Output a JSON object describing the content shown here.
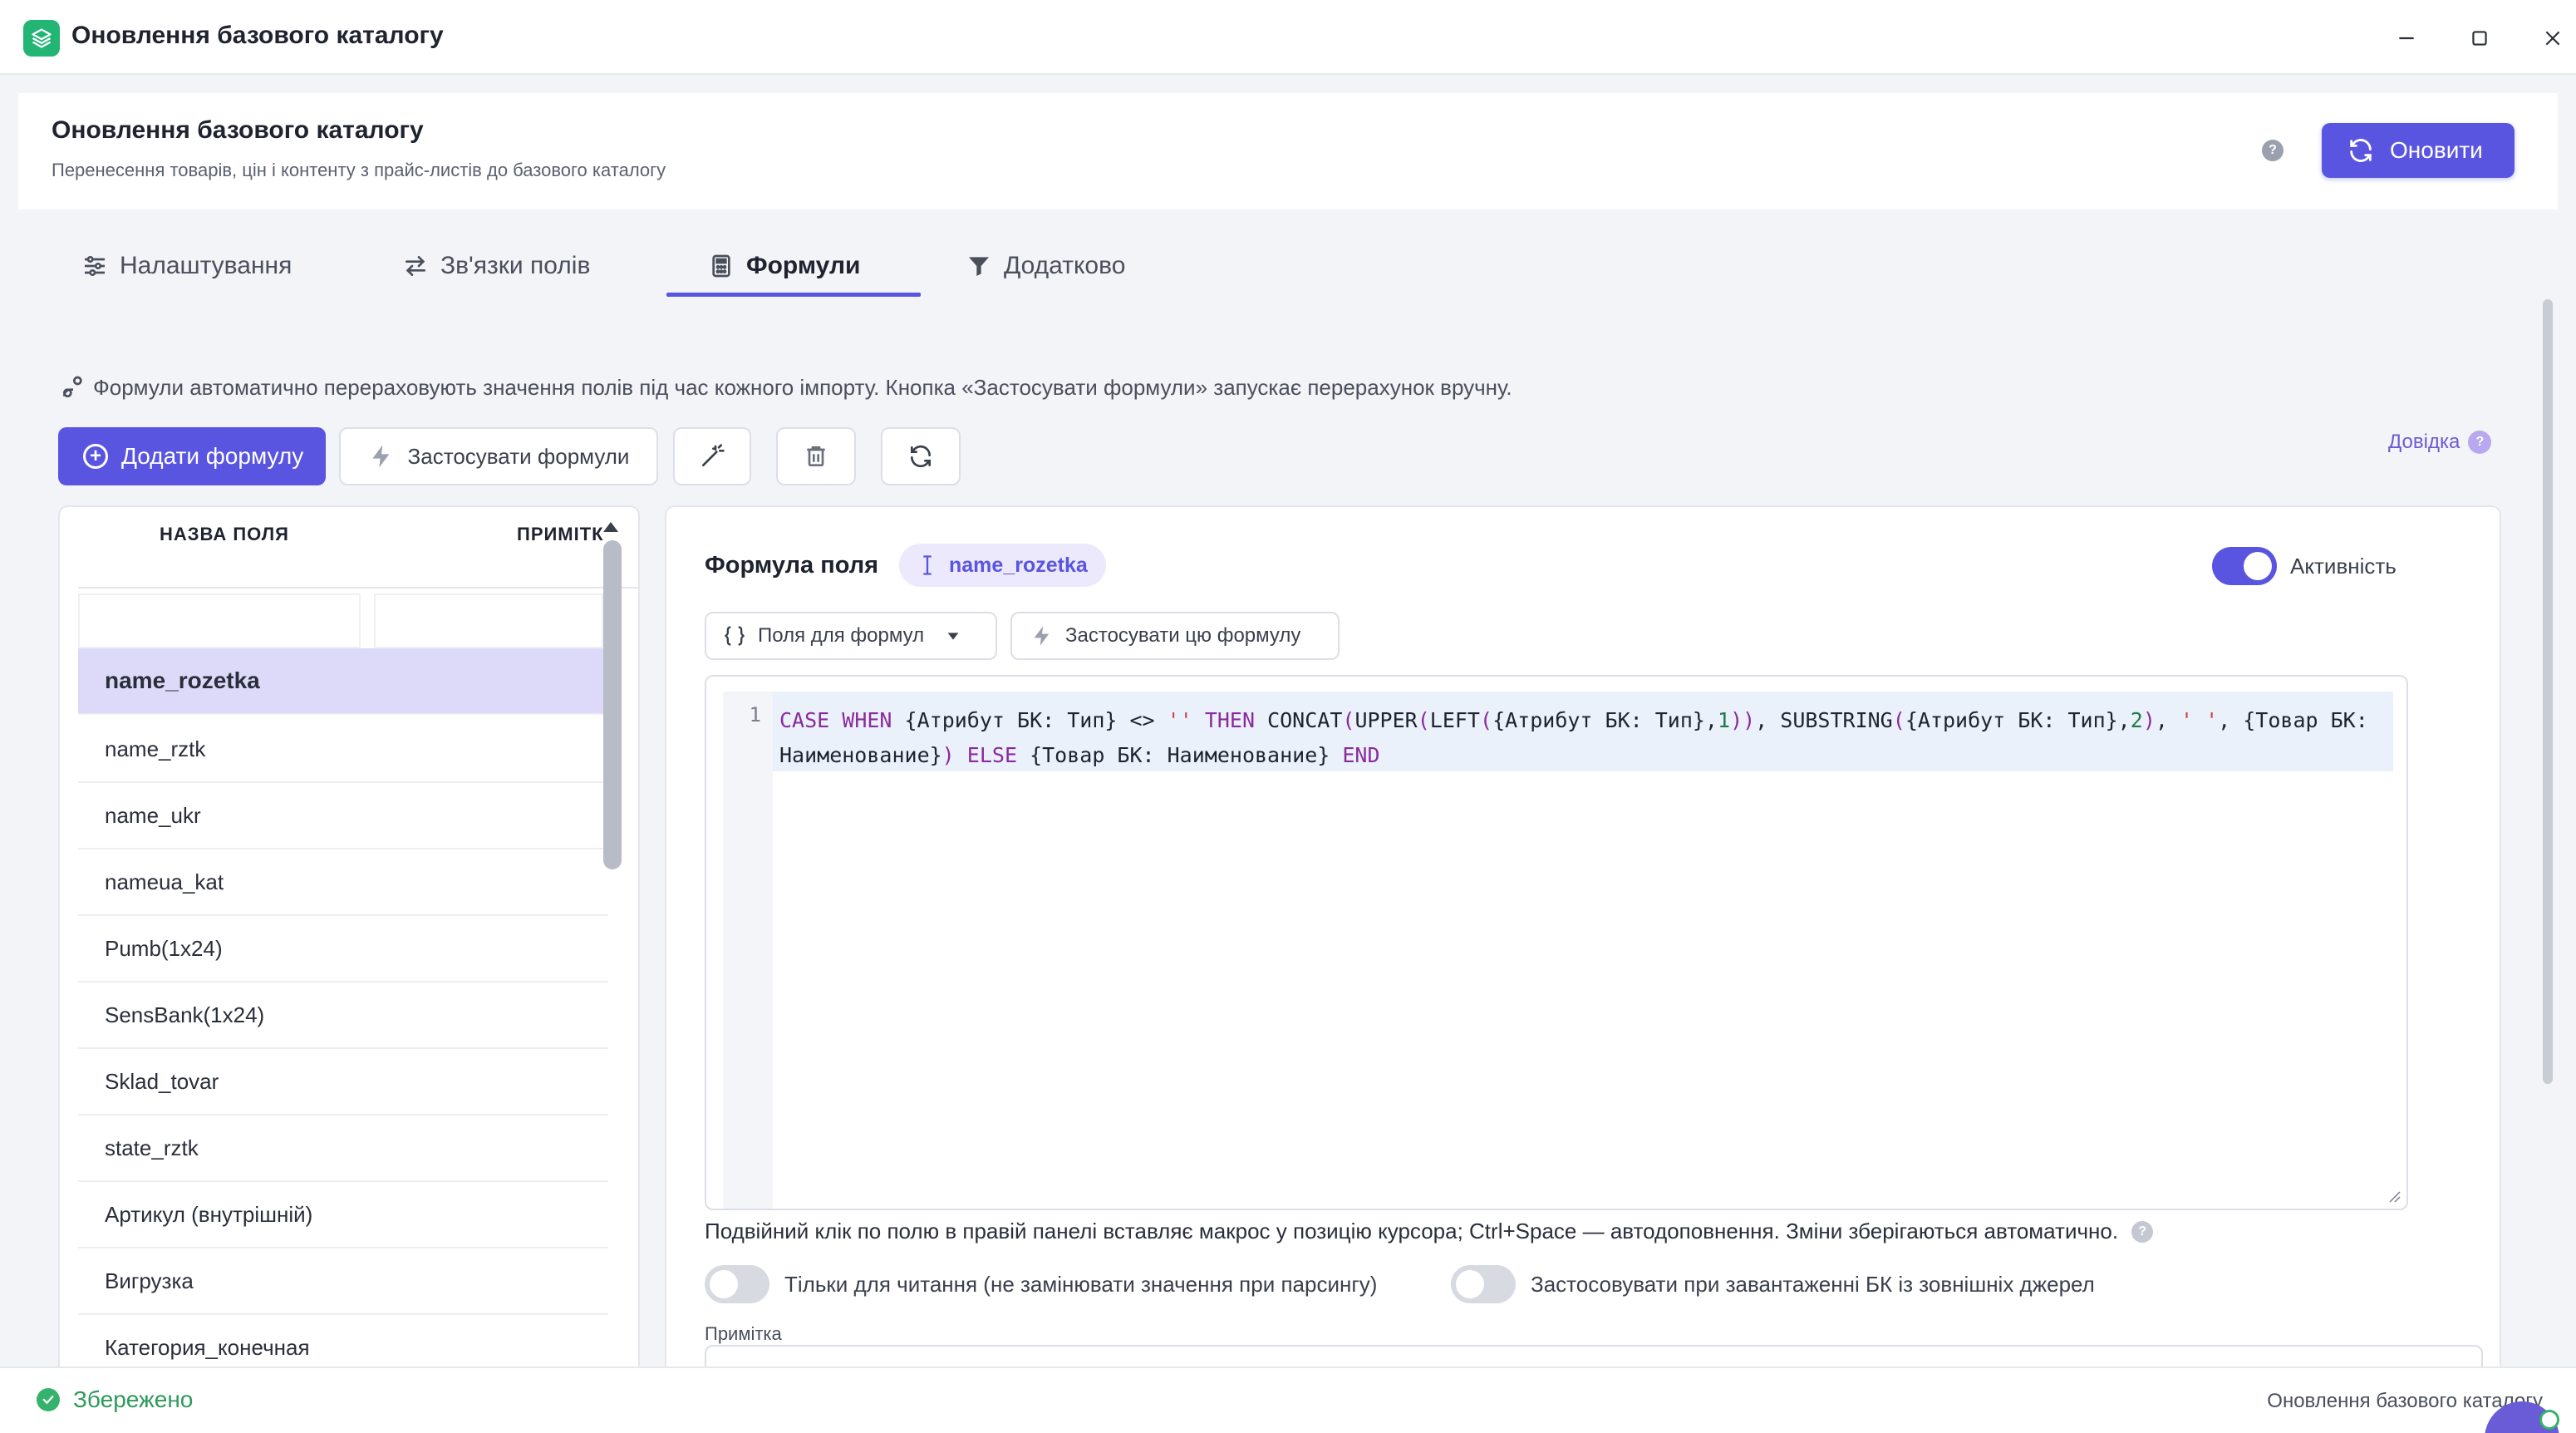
{
  "window": {
    "title": "Оновлення базового каталогу"
  },
  "header": {
    "title": "Оновлення базового каталогу",
    "subtitle": "Перенесення товарів, цін і контенту з прайс-листів до базового каталогу",
    "help": "?",
    "update_button": "Оновити"
  },
  "tabs": [
    {
      "label": "Налаштування",
      "icon": "sliders-icon"
    },
    {
      "label": "Зв'язки полів",
      "icon": "arrows-swap-icon"
    },
    {
      "label": "Формули",
      "icon": "calculator-icon",
      "active": true
    },
    {
      "label": "Додатково",
      "icon": "filter-icon"
    }
  ],
  "info_text": "Формули автоматично перераховують значення полів під час кожного імпорту. Кнопка «Застосувати формули» запускає перерахунок вручну.",
  "toolbar": {
    "add_formula": "Додати формулу",
    "apply_formulas": "Застосувати формули",
    "help_link": "Довідка",
    "help_dot": "?"
  },
  "field_list": {
    "columns": [
      "НАЗВА ПОЛЯ",
      "ПРИМІТК"
    ],
    "rows": [
      {
        "name": "name_rozetka",
        "selected": true
      },
      {
        "name": "name_rztk"
      },
      {
        "name": "name_ukr"
      },
      {
        "name": "nameua_kat"
      },
      {
        "name": "Pumb(1x24)"
      },
      {
        "name": "SensBank(1x24)"
      },
      {
        "name": "Sklad_tovar"
      },
      {
        "name": "state_rztk"
      },
      {
        "name": "Артикул (внутрішній)"
      },
      {
        "name": "Вигрузка"
      },
      {
        "name": "Категория_конечная"
      }
    ]
  },
  "formula_panel": {
    "title": "Формула поля",
    "field_chip": "name_rozetka",
    "active_label": "Активність",
    "active": true,
    "fields_button": "Поля для формул",
    "apply_this_button": "Застосувати цю формулу",
    "line_number": "1",
    "code_tokens": {
      "t1": "CASE",
      "t2": " ",
      "t3": "WHEN",
      "t4": " {Атрибут БК: Тип} <> ",
      "t5": "''",
      "t6": " ",
      "t7": "THEN",
      "t8": " CONCAT",
      "t9": "(",
      "t10": "UPPER",
      "t11": "(",
      "t12": "LEFT",
      "t13": "(",
      "t14": "{Атрибут БК: Тип},",
      "t15": "1",
      "t16": "))",
      "t17": ", SUBSTRING",
      "t18": "(",
      "t19": "{Атрибут БК: Тип},",
      "t20": "2",
      "t21": ")",
      "t22": ", ",
      "t23": "' '",
      "t24": ", {Товар БК: Наименование}",
      "t25": ")",
      "t26": " ",
      "t27": "ELSE",
      "t28": " {Товар БК: Наименование} ",
      "t29": "END"
    },
    "hint": "Подвійний клік по полю в правій панелі вставляє макрос у позицію курсора; Ctrl+Space — автодоповнення. Зміни зберігаються автоматично.",
    "hint_help": "?",
    "readonly_label": "Тільки для читання (не замінювати значення при парсингу)",
    "readonly": false,
    "external_label": "Застосовувати при завантаженні БК із зовнішніх джерел",
    "external": false,
    "note_label": "Примітка"
  },
  "statusbar": {
    "saved": "Збережено",
    "right_text": "Оновлення базового каталогу"
  },
  "colors": {
    "accent": "#5a55e0",
    "success": "#35b36c",
    "selected_row": "#dcdaf8"
  }
}
